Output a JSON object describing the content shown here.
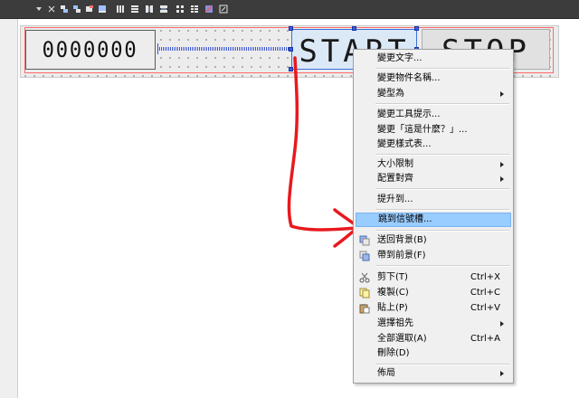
{
  "toolbar": {
    "icons": [
      "dropdown-arrow-icon",
      "close-icon",
      "align-left-icon",
      "align-top-icon",
      "align-right-icon",
      "align-bottom-icon",
      "layout-horizontal-icon",
      "layout-vertical-icon",
      "split-horizontal-icon",
      "split-vertical-icon",
      "grid-layout-icon",
      "form-layout-icon",
      "break-layout-icon"
    ]
  },
  "form": {
    "lcd_value": "0000000",
    "start_button_label": "START",
    "stop_button_label": "STOP"
  },
  "context_menu": {
    "items": [
      {
        "label": "變更文字...",
        "type": "item"
      },
      {
        "type": "separator"
      },
      {
        "label": "變更物件名稱...",
        "type": "item"
      },
      {
        "label": "變型為",
        "type": "submenu"
      },
      {
        "type": "separator"
      },
      {
        "label": "變更工具提示...",
        "type": "item"
      },
      {
        "label": "變更「這是什麼？」...",
        "type": "item"
      },
      {
        "label": "變更樣式表...",
        "type": "item"
      },
      {
        "type": "separator"
      },
      {
        "label": "大小限制",
        "type": "submenu"
      },
      {
        "label": "配置對齊",
        "type": "submenu"
      },
      {
        "type": "separator"
      },
      {
        "label": "提升到...",
        "type": "item"
      },
      {
        "type": "separator"
      },
      {
        "label": "跳到信號槽...",
        "type": "item",
        "highlighted": true
      },
      {
        "type": "separator"
      },
      {
        "label": "送回背景(B)",
        "type": "item",
        "icon": "send-to-back-icon"
      },
      {
        "label": "帶到前景(F)",
        "type": "item",
        "icon": "bring-to-front-icon"
      },
      {
        "type": "separator"
      },
      {
        "label": "剪下(T)",
        "shortcut": "Ctrl+X",
        "type": "item",
        "icon": "scissors-icon"
      },
      {
        "label": "複製(C)",
        "shortcut": "Ctrl+C",
        "type": "item",
        "icon": "copy-icon"
      },
      {
        "label": "貼上(P)",
        "shortcut": "Ctrl+V",
        "type": "item",
        "icon": "paste-icon"
      },
      {
        "label": "選擇祖先",
        "type": "submenu"
      },
      {
        "label": "全部選取(A)",
        "shortcut": "Ctrl+A",
        "type": "item"
      },
      {
        "label": "刪除(D)",
        "type": "item"
      },
      {
        "type": "separator"
      },
      {
        "label": "佈局",
        "type": "submenu"
      }
    ]
  },
  "colors": {
    "highlight": "#99ccff",
    "selection_handle": "#3b5bdb",
    "annotation_arrow": "#e8191e",
    "layout_frame": "#ff6b6b"
  }
}
